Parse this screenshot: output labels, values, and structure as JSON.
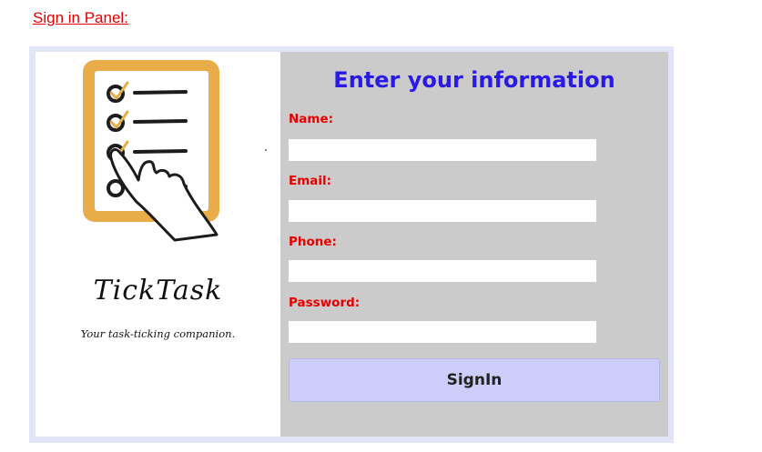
{
  "caption": "Sign in Panel:",
  "brand": {
    "name": "TickTask",
    "tagline": "Your task-ticking companion."
  },
  "form": {
    "title": "Enter your information",
    "fields": [
      {
        "label": "Name:",
        "value": ""
      },
      {
        "label": "Email:",
        "value": ""
      },
      {
        "label": "Phone:",
        "value": ""
      },
      {
        "label": "Password:",
        "value": ""
      }
    ],
    "submit_label": "SignIn"
  },
  "colors": {
    "caption": "#e00000",
    "title": "#2a1ae6",
    "labels": "#e60000",
    "form_panel": "#cbcbcb",
    "button": "#cccdf9",
    "logo_frame": "#e8ad48"
  },
  "icons": {
    "logo": "checklist-with-pointing-hand-icon"
  }
}
